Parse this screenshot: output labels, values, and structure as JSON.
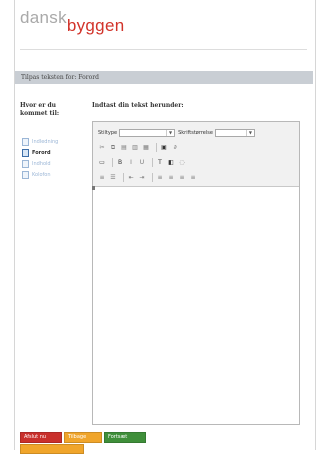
{
  "brand": {
    "logo_part1": "dansk",
    "logo_part2": "byggen"
  },
  "page": {
    "title": "Tilpas teksten for: Forord"
  },
  "left_panel": {
    "question": "Hvor er du kommet til:",
    "steps": [
      {
        "label": "Indledning",
        "active": false
      },
      {
        "label": "Forord",
        "active": true
      },
      {
        "label": "Indhold",
        "active": false
      },
      {
        "label": "Kolofon",
        "active": false
      }
    ]
  },
  "editor": {
    "prompt": "Indtast din tekst herunder:",
    "style_label": "Stiltype",
    "style_value": "",
    "font_size_label": "Skriftstørrelse",
    "font_size_value": ""
  },
  "footer": {
    "cancel_label": "Afslut nu",
    "back_label": "Tilbage",
    "continue_label": "Fortsæt",
    "extra_label": ""
  }
}
